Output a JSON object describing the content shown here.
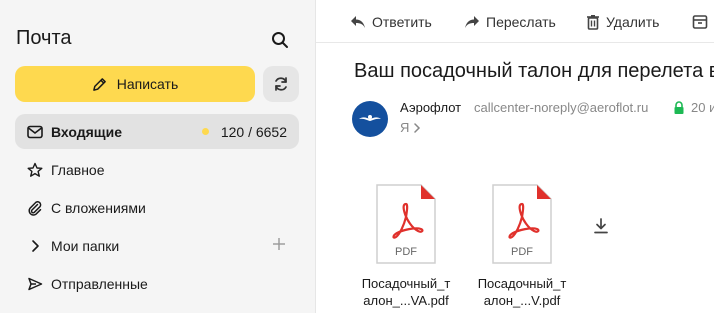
{
  "sidebar": {
    "brand": "Почта",
    "compose_label": "Написать",
    "folders": [
      {
        "label": "Входящие",
        "count": "120 / 6652"
      },
      {
        "label": "Главное"
      },
      {
        "label": "С вложениями"
      },
      {
        "label": "Мои папки"
      },
      {
        "label": "Отправленные"
      }
    ]
  },
  "toolbar": {
    "reply_label": "Ответить",
    "forward_label": "Переслать",
    "delete_label": "Удалить"
  },
  "message": {
    "subject": "Ваш посадочный талон для перелета в",
    "sender_name": "Аэрофлот",
    "sender_email": "callcenter-noreply@aeroflot.ru",
    "date": "20 и",
    "recipient": "Я",
    "attachments": [
      {
        "line1": "Посадочный_т",
        "line2": "алон_...VA.pdf",
        "type": "PDF"
      },
      {
        "line1": "Посадочный_т",
        "line2": "алон_...V.pdf",
        "type": "PDF"
      }
    ]
  },
  "colors": {
    "accent": "#fed94f",
    "secure": "#1db954",
    "pdf_red": "#e0312c",
    "avatar_bg": "#14509e"
  }
}
